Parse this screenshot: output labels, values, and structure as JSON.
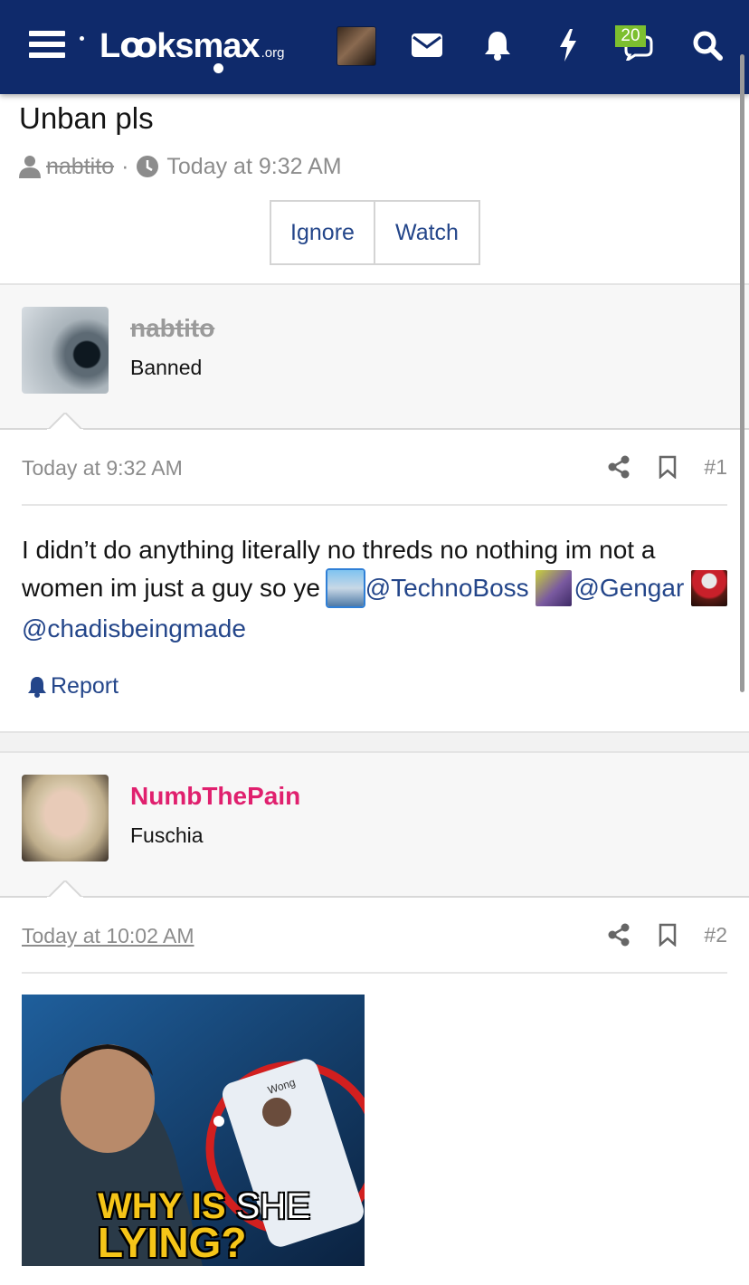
{
  "header": {
    "logo_main": "Lꝏksmax",
    "logo_suffix": ".org",
    "conversations_badge": "20"
  },
  "thread": {
    "title": "Unban pls",
    "author": "nabtito",
    "separator": "·",
    "time": "Today at 9:32 AM",
    "ignore_label": "Ignore",
    "watch_label": "Watch"
  },
  "posts": [
    {
      "username": "nabtito",
      "user_title": "Banned",
      "date": "Today at 9:32 AM",
      "number": "#1",
      "text": "I didn’t do anything literally no threds no nothing im not a women im just a guy so ye",
      "mentions": [
        "@TechnoBoss",
        "@Gengar",
        "@chadisbeingmade"
      ],
      "report_label": "Report"
    },
    {
      "username": "NumbThePain",
      "user_title": "Fuschia",
      "username_color": "#e0206e",
      "date": "Today at 10:02 AM",
      "number": "#2",
      "gif_text_1": "WHY IS",
      "gif_text_2": "SHE",
      "gif_text_3": "LYING?",
      "gif_app_text": "Wong"
    }
  ],
  "colors": {
    "navbar": "#0f2a6b",
    "link": "#24468a",
    "badge": "#7cbf2f",
    "muted": "#8c8c8c"
  }
}
